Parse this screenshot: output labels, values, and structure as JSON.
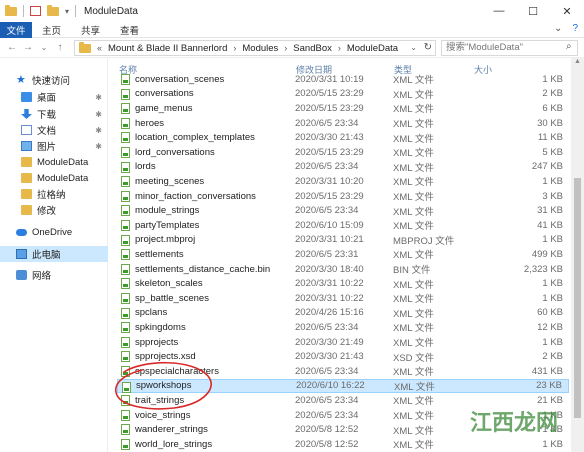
{
  "window": {
    "title": "ModuleData",
    "controls": [
      "—",
      "☐",
      "✕"
    ]
  },
  "ribbon": {
    "tabs": [
      "文件",
      "主页",
      "共享",
      "查看"
    ]
  },
  "address": {
    "crumbs": [
      "Mount & Blade II Bannerlord",
      "Modules",
      "SandBox",
      "ModuleData"
    ],
    "search_placeholder": "搜索\"ModuleData\""
  },
  "sidebar": {
    "items": [
      {
        "label": "快速访问",
        "icon": "star-icon"
      },
      {
        "label": "桌面",
        "icon": "desktop-icon",
        "pinned": true
      },
      {
        "label": "下载",
        "icon": "download-icon",
        "pinned": true
      },
      {
        "label": "文档",
        "icon": "document-icon",
        "pinned": true
      },
      {
        "label": "图片",
        "icon": "picture-icon",
        "pinned": true
      },
      {
        "label": "ModuleData",
        "icon": "folder-icon"
      },
      {
        "label": "ModuleData",
        "icon": "folder-icon"
      },
      {
        "label": "拉格纳",
        "icon": "folder-icon"
      },
      {
        "label": "修改",
        "icon": "folder-icon"
      },
      {
        "label": "OneDrive",
        "icon": "cloud-icon"
      },
      {
        "label": "此电脑",
        "icon": "computer-icon",
        "selected": true
      },
      {
        "label": "网络",
        "icon": "network-icon"
      }
    ]
  },
  "columns": {
    "name": "名称",
    "date": "修改日期",
    "type": "类型",
    "size": "大小"
  },
  "files": [
    {
      "name": "conversation_scenes",
      "date": "2020/3/31 10:19",
      "type": "XML 文件",
      "size": "1 KB"
    },
    {
      "name": "conversations",
      "date": "2020/5/15 23:29",
      "type": "XML 文件",
      "size": "2 KB"
    },
    {
      "name": "game_menus",
      "date": "2020/5/15 23:29",
      "type": "XML 文件",
      "size": "6 KB"
    },
    {
      "name": "heroes",
      "date": "2020/6/5 23:34",
      "type": "XML 文件",
      "size": "30 KB"
    },
    {
      "name": "location_complex_templates",
      "date": "2020/3/30 21:43",
      "type": "XML 文件",
      "size": "11 KB"
    },
    {
      "name": "lord_conversations",
      "date": "2020/5/15 23:29",
      "type": "XML 文件",
      "size": "5 KB"
    },
    {
      "name": "lords",
      "date": "2020/6/5 23:34",
      "type": "XML 文件",
      "size": "247 KB"
    },
    {
      "name": "meeting_scenes",
      "date": "2020/3/31 10:20",
      "type": "XML 文件",
      "size": "1 KB"
    },
    {
      "name": "minor_faction_conversations",
      "date": "2020/5/15 23:29",
      "type": "XML 文件",
      "size": "3 KB"
    },
    {
      "name": "module_strings",
      "date": "2020/6/5 23:34",
      "type": "XML 文件",
      "size": "31 KB"
    },
    {
      "name": "partyTemplates",
      "date": "2020/6/10 15:09",
      "type": "XML 文件",
      "size": "41 KB"
    },
    {
      "name": "project.mbproj",
      "date": "2020/3/31 10:21",
      "type": "MBPROJ 文件",
      "size": "1 KB"
    },
    {
      "name": "settlements",
      "date": "2020/6/5 23:31",
      "type": "XML 文件",
      "size": "499 KB"
    },
    {
      "name": "settlements_distance_cache.bin",
      "date": "2020/3/30 18:40",
      "type": "BIN 文件",
      "size": "2,323 KB"
    },
    {
      "name": "skeleton_scales",
      "date": "2020/3/31 10:22",
      "type": "XML 文件",
      "size": "1 KB"
    },
    {
      "name": "sp_battle_scenes",
      "date": "2020/3/31 10:22",
      "type": "XML 文件",
      "size": "1 KB"
    },
    {
      "name": "spclans",
      "date": "2020/4/26 15:16",
      "type": "XML 文件",
      "size": "60 KB"
    },
    {
      "name": "spkingdoms",
      "date": "2020/6/5 23:34",
      "type": "XML 文件",
      "size": "12 KB"
    },
    {
      "name": "spprojects",
      "date": "2020/3/30 21:49",
      "type": "XML 文件",
      "size": "1 KB"
    },
    {
      "name": "spprojects.xsd",
      "date": "2020/3/30 21:43",
      "type": "XSD 文件",
      "size": "2 KB"
    },
    {
      "name": "spspecialcharacters",
      "date": "2020/6/5 23:34",
      "type": "XML 文件",
      "size": "431 KB"
    },
    {
      "name": "spworkshops",
      "date": "2020/6/10 16:22",
      "type": "XML 文件",
      "size": "23 KB",
      "selected": true
    },
    {
      "name": "trait_strings",
      "date": "2020/6/5 23:34",
      "type": "XML 文件",
      "size": "21 KB"
    },
    {
      "name": "voice_strings",
      "date": "2020/6/5 23:34",
      "type": "XML 文件",
      "size": "1 KB"
    },
    {
      "name": "wanderer_strings",
      "date": "2020/5/8 12:52",
      "type": "XML 文件",
      "size": "1 KB"
    },
    {
      "name": "world_lore_strings",
      "date": "2020/5/8 12:52",
      "type": "XML 文件",
      "size": "1 KB"
    }
  ],
  "watermark": "江西龙网",
  "colors": {
    "accent": "#1a5fb4",
    "selection": "#cce8ff",
    "annotation": "#d92a2a"
  }
}
